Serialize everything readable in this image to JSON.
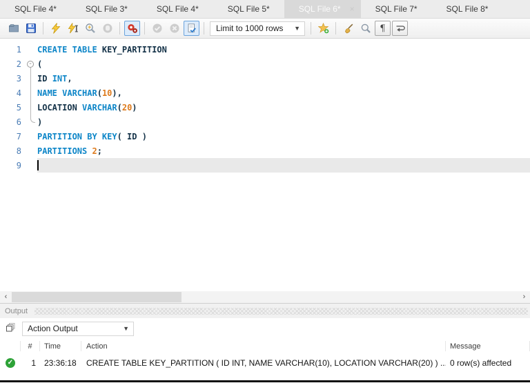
{
  "tabs": {
    "close_glyph": "×",
    "items": [
      {
        "label": "SQL File 4*",
        "active": false
      },
      {
        "label": "SQL File 3*",
        "active": false
      },
      {
        "label": "SQL File 4*",
        "active": false
      },
      {
        "label": "SQL File 5*",
        "active": false
      },
      {
        "label": "SQL File 6*",
        "active": true
      },
      {
        "label": "SQL File 7*",
        "active": false
      },
      {
        "label": "SQL File 8*",
        "active": false
      }
    ]
  },
  "toolbar": {
    "items": [
      {
        "type": "icon",
        "name": "open-file",
        "enabled": true
      },
      {
        "type": "icon",
        "name": "save",
        "enabled": true
      },
      {
        "type": "sep"
      },
      {
        "type": "icon",
        "name": "execute",
        "enabled": true
      },
      {
        "type": "icon",
        "name": "execute-current",
        "enabled": true
      },
      {
        "type": "icon",
        "name": "explain",
        "enabled": true
      },
      {
        "type": "icon",
        "name": "stop",
        "enabled": false
      },
      {
        "type": "sep"
      },
      {
        "type": "icon",
        "name": "toggle-stop-on-error",
        "enabled": true,
        "toggled": true
      },
      {
        "type": "sep"
      },
      {
        "type": "icon",
        "name": "commit",
        "enabled": false
      },
      {
        "type": "icon",
        "name": "rollback",
        "enabled": false
      },
      {
        "type": "icon",
        "name": "toggle-autocommit",
        "enabled": true,
        "toggled": true
      },
      {
        "type": "sep"
      },
      {
        "type": "dropdown",
        "name": "limit-rows",
        "value": "Limit to 1000 rows"
      },
      {
        "type": "sep"
      },
      {
        "type": "icon",
        "name": "save-snippet",
        "enabled": true
      },
      {
        "type": "sep"
      },
      {
        "type": "icon",
        "name": "beautify",
        "enabled": true
      },
      {
        "type": "icon",
        "name": "find",
        "enabled": true
      },
      {
        "type": "icon",
        "name": "invisibles",
        "enabled": true,
        "boxed": true
      },
      {
        "type": "icon",
        "name": "wrap-text",
        "enabled": true,
        "boxed": true
      }
    ]
  },
  "editor": {
    "caret_line": 9,
    "lines": [
      {
        "num": 1,
        "tokens": [
          {
            "text": "CREATE TABLE ",
            "type": "kw"
          },
          {
            "text": "KEY_PARTITION",
            "type": "id"
          }
        ]
      },
      {
        "num": 2,
        "fold": "start",
        "tokens": [
          {
            "text": "(",
            "type": "pl"
          }
        ]
      },
      {
        "num": 3,
        "fold": "mid",
        "tokens": [
          {
            "text": "ID ",
            "type": "id"
          },
          {
            "text": "INT",
            "type": "kw"
          },
          {
            "text": ",",
            "type": "pl"
          }
        ]
      },
      {
        "num": 4,
        "fold": "mid",
        "tokens": [
          {
            "text": "NAME VARCHAR",
            "type": "kw"
          },
          {
            "text": "(",
            "type": "pl"
          },
          {
            "text": "10",
            "type": "num"
          },
          {
            "text": "),",
            "type": "pl"
          }
        ]
      },
      {
        "num": 5,
        "fold": "mid",
        "tokens": [
          {
            "text": "LOCATION ",
            "type": "id"
          },
          {
            "text": "VARCHAR",
            "type": "kw"
          },
          {
            "text": "(",
            "type": "pl"
          },
          {
            "text": "20",
            "type": "num"
          },
          {
            "text": ")",
            "type": "pl"
          }
        ]
      },
      {
        "num": 6,
        "fold": "end",
        "tokens": [
          {
            "text": ")",
            "type": "pl"
          }
        ]
      },
      {
        "num": 7,
        "tokens": [
          {
            "text": "PARTITION BY KEY",
            "type": "kw"
          },
          {
            "text": "( ",
            "type": "pl"
          },
          {
            "text": "ID",
            "type": "id"
          },
          {
            "text": " )",
            "type": "pl"
          }
        ]
      },
      {
        "num": 8,
        "tokens": [
          {
            "text": "PARTITIONS ",
            "type": "kw"
          },
          {
            "text": "2",
            "type": "num"
          },
          {
            "text": ";",
            "type": "pl"
          }
        ]
      },
      {
        "num": 9,
        "current": true,
        "tokens": []
      }
    ]
  },
  "scrollbar": {
    "left_arrow": "‹",
    "right_arrow": "›"
  },
  "output": {
    "panel_title": "Output",
    "view_selector": "Action Output",
    "table": {
      "columns": [
        "#",
        "Time",
        "Action",
        "Message"
      ],
      "rows": [
        {
          "status": "success",
          "index": "1",
          "time": "23:36:18",
          "action": "CREATE TABLE KEY_PARTITION ( ID INT, NAME VARCHAR(10), LOCATION VARCHAR(20) ) ...",
          "message": "0 row(s) affected"
        }
      ]
    }
  },
  "colors": {
    "keyword": "#0e86c8",
    "number_literal": "#dd7a1c",
    "identifier": "#143248",
    "line_number": "#4a7cb5",
    "toggle_border": "#6ba3dc",
    "success_green": "#2da237",
    "current_line_bg": "#e9e9e9"
  }
}
